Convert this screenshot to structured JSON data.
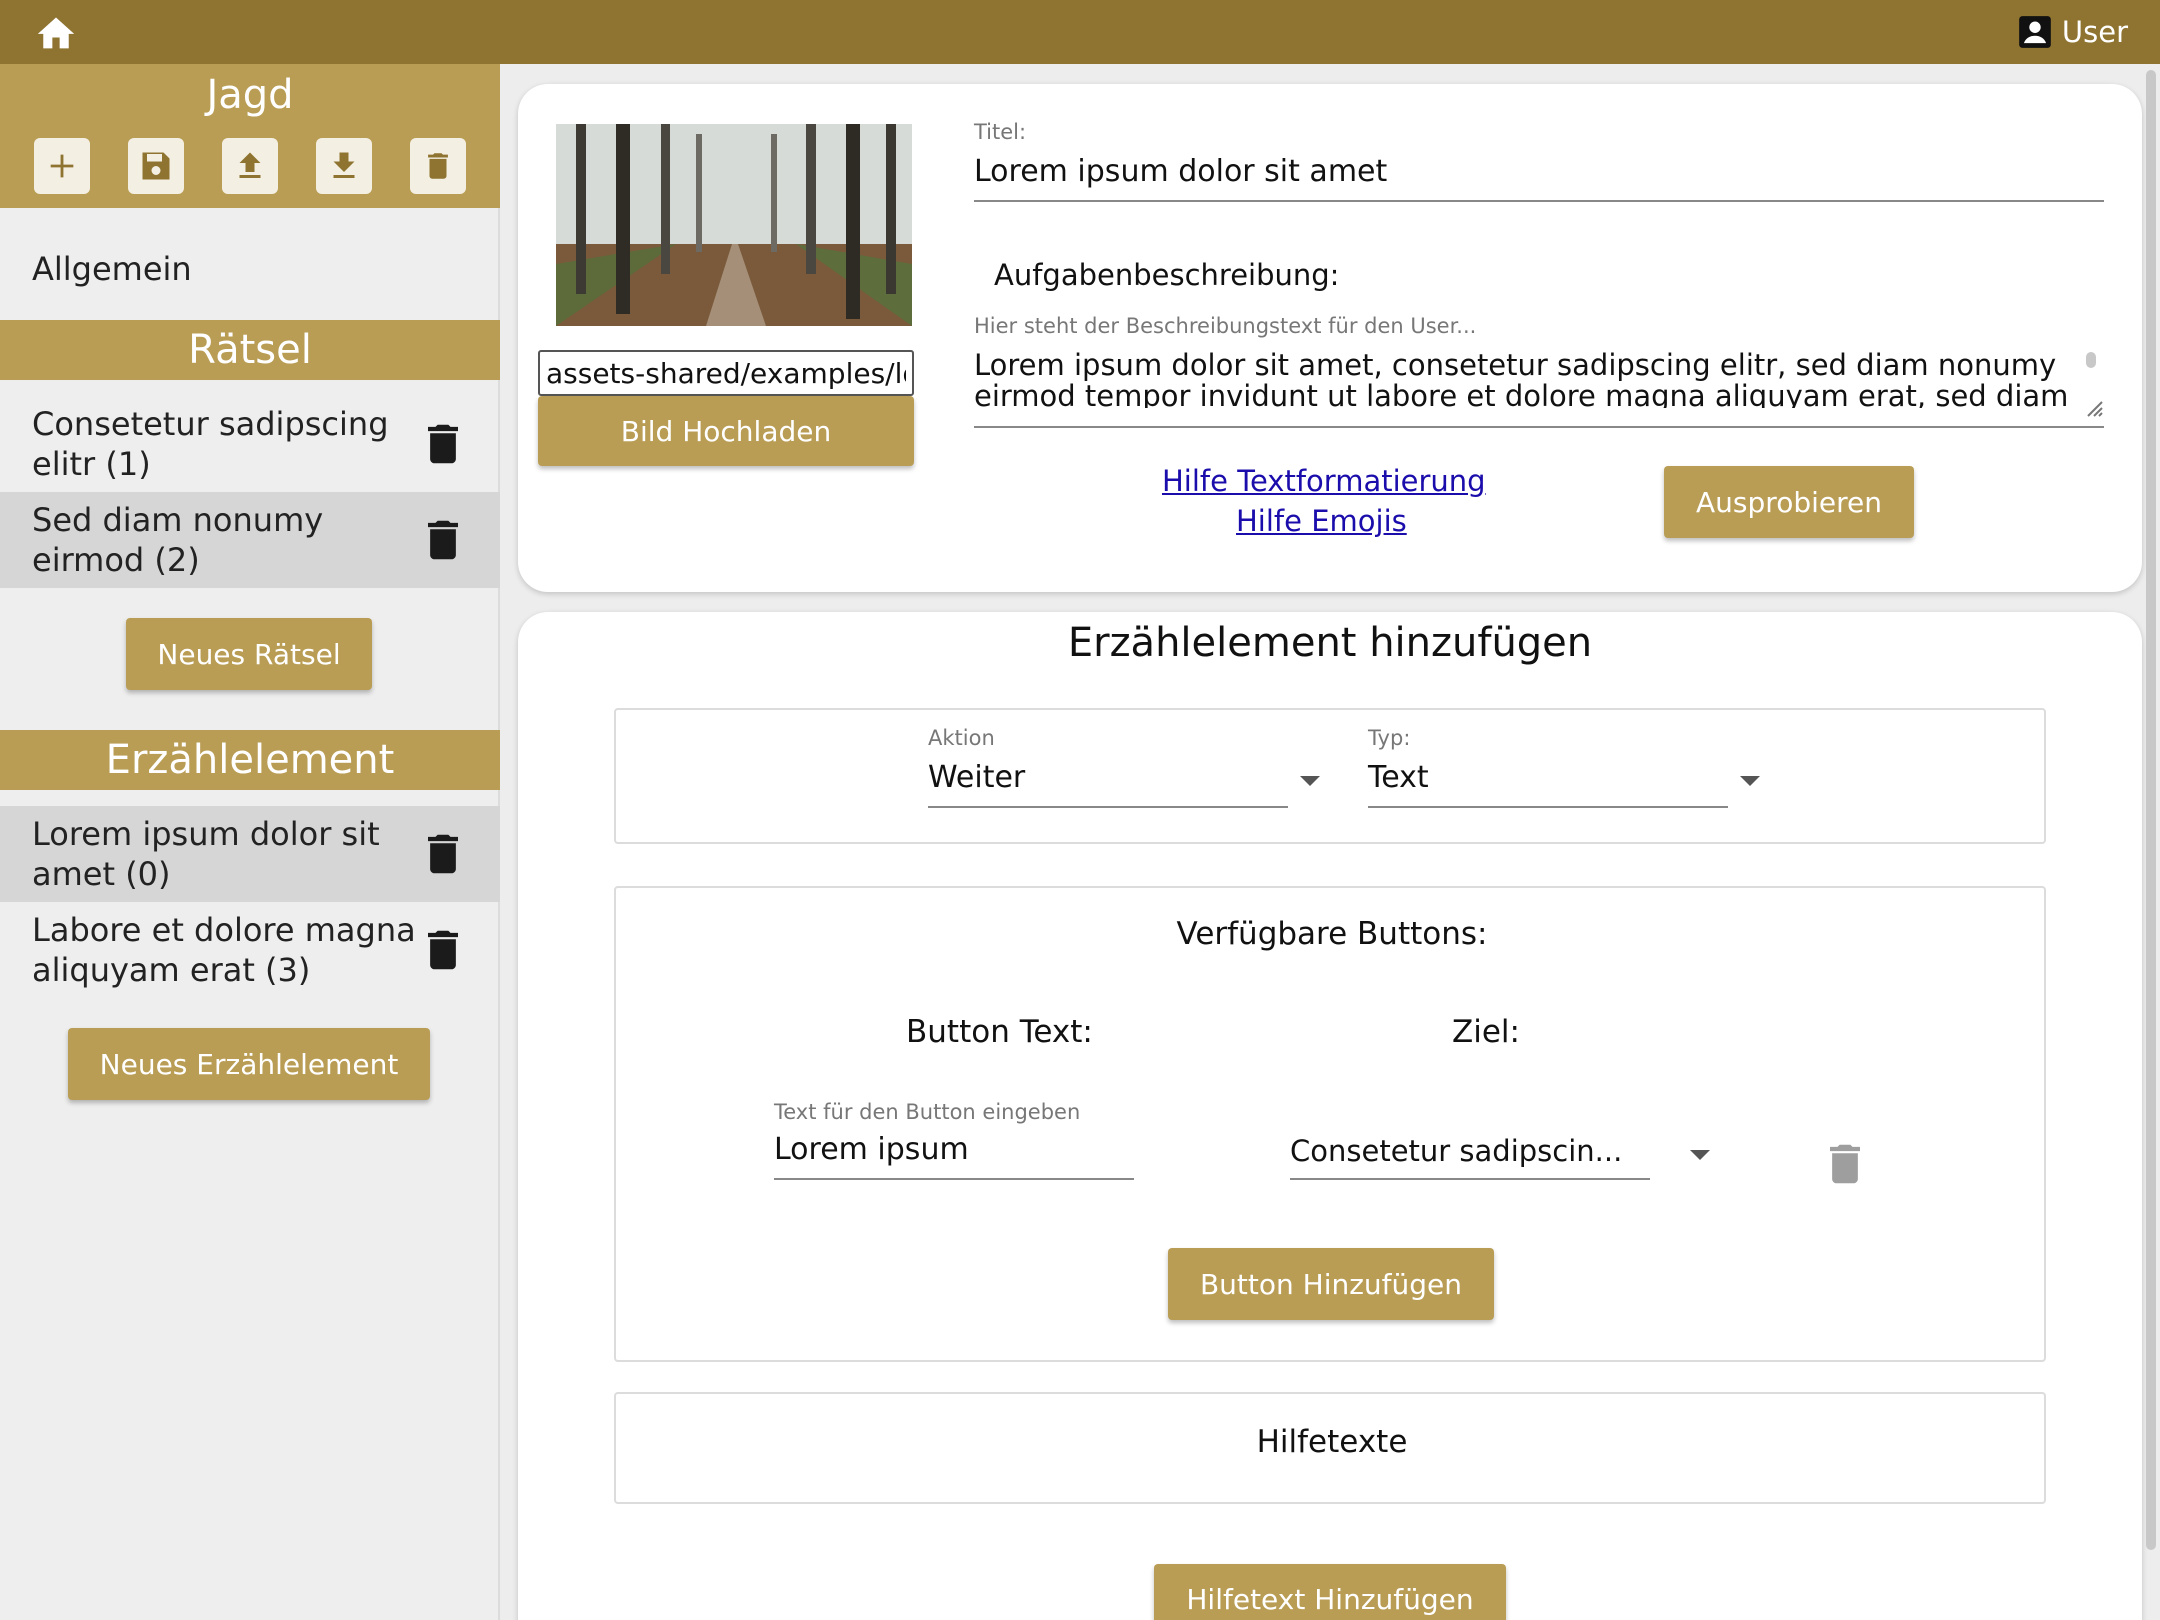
{
  "topbar": {
    "home_icon": "home-icon",
    "user_label": "User",
    "user_icon": "account-box-icon"
  },
  "sidebar": {
    "title": "Jagd",
    "tools": [
      "plus-icon",
      "save-icon",
      "upload-icon",
      "download-icon",
      "trash-icon"
    ],
    "general_label": "Allgemein",
    "raetsel_header": "Rätsel",
    "raetsel_items": [
      {
        "line1": "Consetetur sadipscing",
        "line2": "elitr (1)",
        "selected": false
      },
      {
        "line1": "Sed diam nonumy",
        "line2": "eirmod (2)",
        "selected": true
      }
    ],
    "new_raetsel_label": "Neues Rätsel",
    "erzael_header": "Erzählelement",
    "erzael_items": [
      {
        "line1": "Lorem ipsum dolor sit",
        "line2": "amet (0)",
        "selected": true
      },
      {
        "line1": "Labore et dolore magna",
        "line2": "aliquyam erat (3)",
        "selected": false
      }
    ],
    "new_erzael_label": "Neues Erzählelement"
  },
  "editor": {
    "image_path": "assets-shared/examples/lorem.jpg",
    "upload_label": "Bild Hochladen",
    "title_label": "Titel:",
    "title_value": "Lorem ipsum dolor sit amet",
    "description_heading": "Aufgabenbeschreibung:",
    "description_hint": "Hier steht der Beschreibungstext für den User...",
    "description_text": "Lorem ipsum dolor sit amet, consetetur sadipscing elitr, sed diam nonumy eirmod tempor invidunt ut labore et dolore magna aliquyam erat, sed diam voluptua. At vero eos et accusam et justo duo dolores et ea rebum.",
    "help_format_link": "Hilfe Textformatierung",
    "help_emoji_link": "Hilfe Emojis",
    "try_label": "Ausprobieren"
  },
  "add_element": {
    "heading": "Erzählelement hinzufügen",
    "action_label": "Aktion",
    "action_value": "Weiter",
    "type_label": "Typ:",
    "type_value": "Text",
    "buttons_heading": "Verfügbare Buttons:",
    "col_button_text": "Button Text:",
    "col_target": "Ziel:",
    "button_text_hint": "Text für den Button eingeben",
    "button_text_value": "Lorem ipsum",
    "target_value": "Consetetur sadipscin...",
    "add_button_label": "Button Hinzufügen",
    "helptexts_heading": "Hilfetexte",
    "add_helptext_label": "Hilfetext Hinzufügen"
  },
  "colors": {
    "topbar": "#8e7430",
    "gold": "#b99d55",
    "selected": "#d6d6d6",
    "link": "#1a0dab"
  }
}
